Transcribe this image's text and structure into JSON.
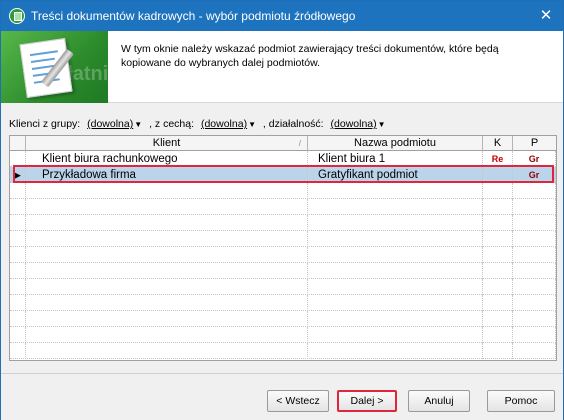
{
  "window": {
    "title": "Treści dokumentów kadrowych - wybór podmiotu źródłowego",
    "close_glyph": "✕"
  },
  "header": {
    "description": "W tym oknie należy wskazać podmiot zawierający treści dokumentów, które będą kopiowane do wybranych dalej podmiotów.",
    "banner_watermark": "płatnik",
    "accent_color": "#2c8b2c"
  },
  "filters": {
    "group_label": "Klienci z grupy:",
    "group_value": "(dowolna)",
    "feature_label": ", z cechą:",
    "feature_value": "(dowolna)",
    "activity_label": ", działalność:",
    "activity_value": "(dowolna)"
  },
  "grid": {
    "columns": {
      "klient": "Klient",
      "nazwa": "Nazwa podmiotu",
      "k": "K",
      "p": "P"
    },
    "rows": [
      {
        "indicator": "",
        "klient": "Klient biura rachunkowego",
        "nazwa": "Klient biura 1",
        "k": "Re",
        "p": "Gr"
      },
      {
        "indicator": "▶",
        "klient": "Przykładowa firma",
        "nazwa": "Gratyfikant podmiot",
        "k": "",
        "p": "Gr"
      }
    ],
    "selected_row": 2,
    "selection_color": "#bcd4ea",
    "highlight_color": "#e0263c"
  },
  "footer": {
    "back_label": "< Wstecz",
    "next_label": "Dalej >",
    "cancel_label": "Anuluj",
    "help_label": "Pomoc"
  }
}
